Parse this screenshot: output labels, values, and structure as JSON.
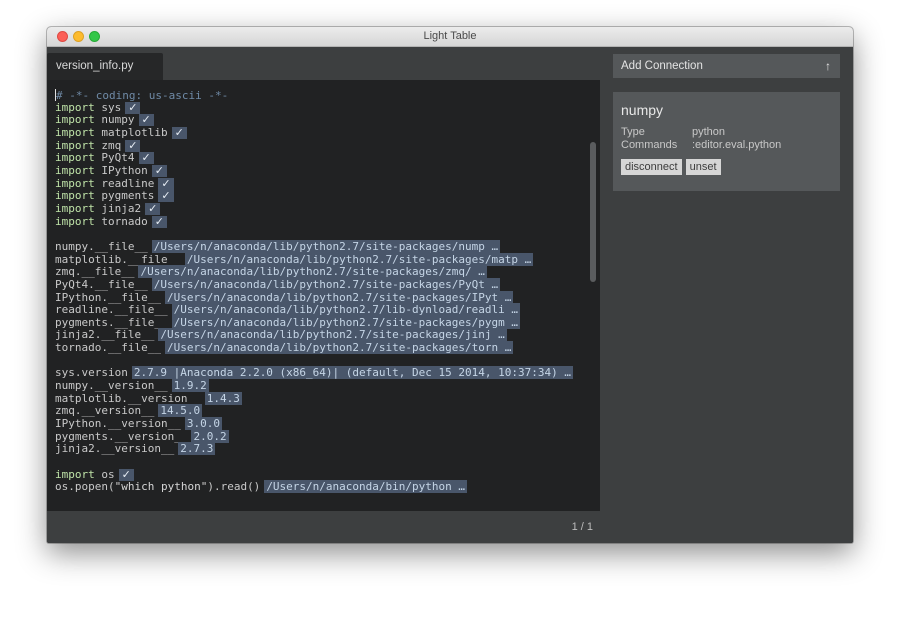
{
  "window": {
    "title": "Light Table"
  },
  "tab": {
    "label": "version_info.py"
  },
  "editor": {
    "lines": [
      {
        "text": "# -*- coding: us-ascii -*-",
        "kind": "comment"
      },
      {
        "kw": "import",
        "text": "sys",
        "result": "✓"
      },
      {
        "kw": "import",
        "text": "numpy",
        "result": "✓"
      },
      {
        "kw": "import",
        "text": "matplotlib",
        "result": "✓"
      },
      {
        "kw": "import",
        "text": "zmq",
        "result": "✓"
      },
      {
        "kw": "import",
        "text": "PyQt4",
        "result": "✓"
      },
      {
        "kw": "import",
        "text": "IPython",
        "result": "✓"
      },
      {
        "kw": "import",
        "text": "readline",
        "result": "✓"
      },
      {
        "kw": "import",
        "text": "pygments",
        "result": "✓"
      },
      {
        "kw": "import",
        "text": "jinja2",
        "result": "✓"
      },
      {
        "kw": "import",
        "text": "tornado",
        "result": "✓"
      },
      {
        "text": ""
      },
      {
        "text": "numpy.__file__",
        "result": "/Users/n/anaconda/lib/python2.7/site-packages/nump …"
      },
      {
        "text": "matplotlib.__file__",
        "result": "/Users/n/anaconda/lib/python2.7/site-packages/matp …"
      },
      {
        "text": "zmq.__file__",
        "result": "/Users/n/anaconda/lib/python2.7/site-packages/zmq/ …"
      },
      {
        "text": "PyQt4.__file__",
        "result": "/Users/n/anaconda/lib/python2.7/site-packages/PyQt …"
      },
      {
        "text": "IPython.__file__",
        "result": "/Users/n/anaconda/lib/python2.7/site-packages/IPyt …"
      },
      {
        "text": "readline.__file__",
        "result": "/Users/n/anaconda/lib/python2.7/lib-dynload/readli …"
      },
      {
        "text": "pygments.__file__",
        "result": "/Users/n/anaconda/lib/python2.7/site-packages/pygm …"
      },
      {
        "text": "jinja2.__file__",
        "result": "/Users/n/anaconda/lib/python2.7/site-packages/jinj …"
      },
      {
        "text": "tornado.__file__",
        "result": "/Users/n/anaconda/lib/python2.7/site-packages/torn …"
      },
      {
        "text": ""
      },
      {
        "text": "sys.version",
        "result": "2.7.9 |Anaconda 2.2.0 (x86_64)| (default, Dec 15 2014, 10:37:34) …"
      },
      {
        "text": "numpy.__version__",
        "result": "1.9.2"
      },
      {
        "text": "matplotlib.__version__",
        "result": "1.4.3"
      },
      {
        "text": "zmq.__version__",
        "result": "14.5.0"
      },
      {
        "text": "IPython.__version__",
        "result": "3.0.0"
      },
      {
        "text": "pygments.__version__",
        "result": "2.0.2"
      },
      {
        "text": "jinja2.__version__",
        "result": "2.7.3"
      },
      {
        "text": ""
      },
      {
        "kw": "import",
        "text": "os",
        "result": "✓"
      },
      {
        "pre": "os.popen(",
        "str": "\"which python\"",
        "post": ").read()",
        "result": "/Users/n/anaconda/bin/python …"
      }
    ]
  },
  "status": {
    "position": "1 / 1"
  },
  "sidebar": {
    "add_connection_label": "Add Connection",
    "add_connection_arrow": "↑",
    "connection": {
      "name": "numpy",
      "type_label": "Type",
      "type_value": "python",
      "commands_label": "Commands",
      "commands_value": ":editor.eval.python",
      "disconnect_label": "disconnect",
      "unset_label": "unset"
    }
  },
  "colors": {
    "editor_bg": "#212223",
    "result_bg": "#49566a",
    "keyword": "#bfe3a8",
    "comment": "#6f8aa6"
  }
}
